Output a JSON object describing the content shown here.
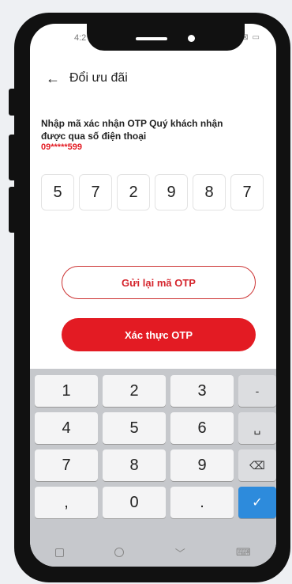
{
  "status": {
    "time": "4:2",
    "icons": "ıl ⊜ ⊠ ▭"
  },
  "header": {
    "title": "Đổi ưu đãi"
  },
  "otp": {
    "instruction": "Nhập mã xác nhận OTP Quý khách nhận được qua số điện thoại",
    "phone": "09*****599",
    "digits": [
      "5",
      "7",
      "2",
      "9",
      "8",
      "7"
    ]
  },
  "buttons": {
    "resend": "Gửi lại mã OTP",
    "verify": "Xác thực OTP"
  },
  "keypad": {
    "keys": [
      "1",
      "2",
      "3",
      "-",
      "4",
      "5",
      "6",
      "␣",
      "7",
      "8",
      "9",
      "⌫",
      ",",
      "0",
      ".",
      "✓"
    ]
  },
  "colors": {
    "accent": "#e31b23",
    "keyboard_ok": "#2d8bdc"
  }
}
